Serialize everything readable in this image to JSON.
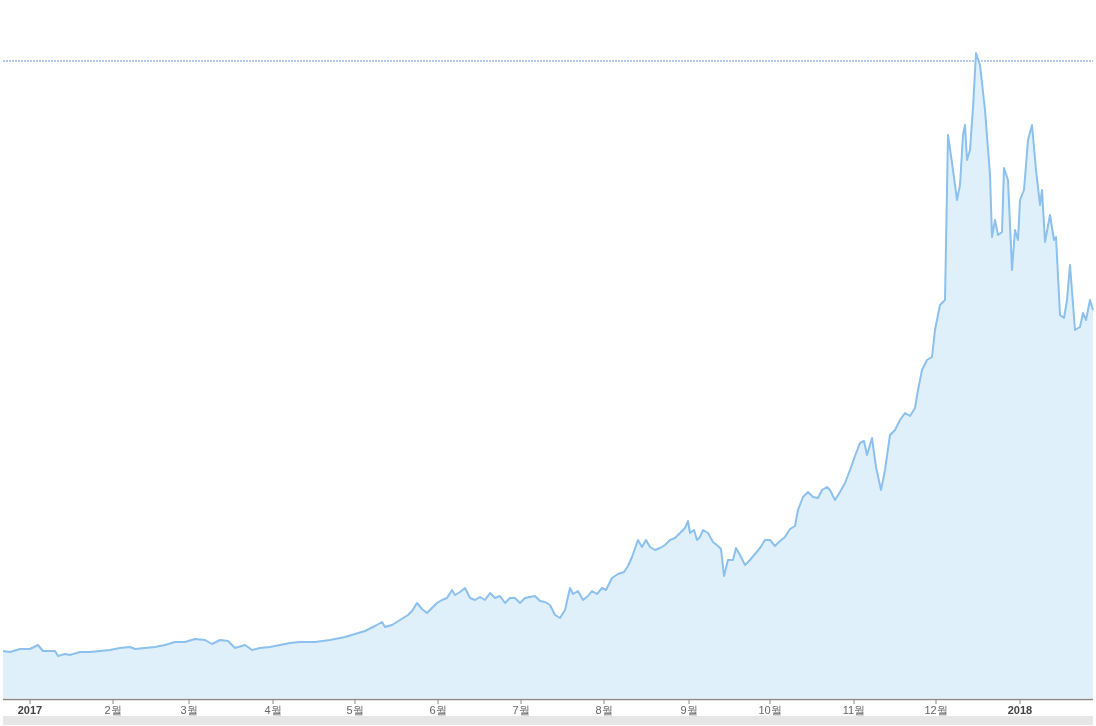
{
  "chart": {
    "x_axis_labels": [
      {
        "text": "2017",
        "kind": "year"
      },
      {
        "text": "2월",
        "kind": "month"
      },
      {
        "text": "3월",
        "kind": "month"
      },
      {
        "text": "4월",
        "kind": "month"
      },
      {
        "text": "5월",
        "kind": "month"
      },
      {
        "text": "6월",
        "kind": "month"
      },
      {
        "text": "7월",
        "kind": "month"
      },
      {
        "text": "8월",
        "kind": "month"
      },
      {
        "text": "9월",
        "kind": "month"
      },
      {
        "text": "10월",
        "kind": "month"
      },
      {
        "text": "11월",
        "kind": "month"
      },
      {
        "text": "12월",
        "kind": "month"
      },
      {
        "text": "2018",
        "kind": "year"
      }
    ]
  }
}
